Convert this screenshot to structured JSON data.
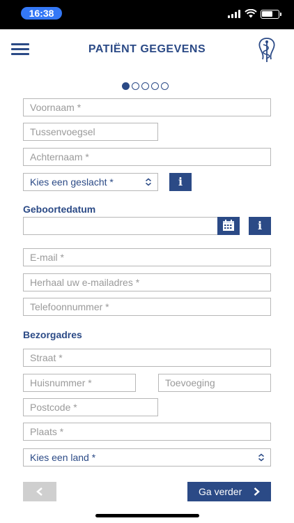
{
  "status_bar": {
    "time": "16:38"
  },
  "header": {
    "title": "PATIËNT GEGEVENS"
  },
  "progress": {
    "total_steps": 5,
    "current_step": 1
  },
  "form": {
    "first_name_placeholder": "Voornaam *",
    "infix_placeholder": "Tussenvoegsel",
    "last_name_placeholder": "Achternaam *",
    "gender_select": "Kies een geslacht *",
    "info_label": "i",
    "birthdate_label": "Geboortedatum",
    "email_placeholder": "E-mail *",
    "email_repeat_placeholder": "Herhaal uw e-mailadres *",
    "phone_placeholder": "Telefoonnummer *",
    "address_label": "Bezorgadres",
    "street_placeholder": "Straat *",
    "house_number_placeholder": "Huisnummer *",
    "addition_placeholder": "Toevoeging",
    "postcode_placeholder": "Postcode *",
    "city_placeholder": "Plaats *",
    "country_select": "Kies een land *"
  },
  "footer": {
    "next_label": "Ga verder"
  },
  "icons": {
    "menu": "hamburger-menu-icon",
    "logo": "caduceus-logo-icon",
    "calendar": "calendar-icon",
    "select": "chevron-up-down-icon",
    "back": "chevron-left-icon",
    "next": "chevron-right-icon"
  },
  "colors": {
    "primary": "#2b4a86",
    "border": "#b7b7b7",
    "placeholder": "#9a9a9a",
    "disabled": "#cfcfcf",
    "status_time_pill": "#3478f6"
  }
}
